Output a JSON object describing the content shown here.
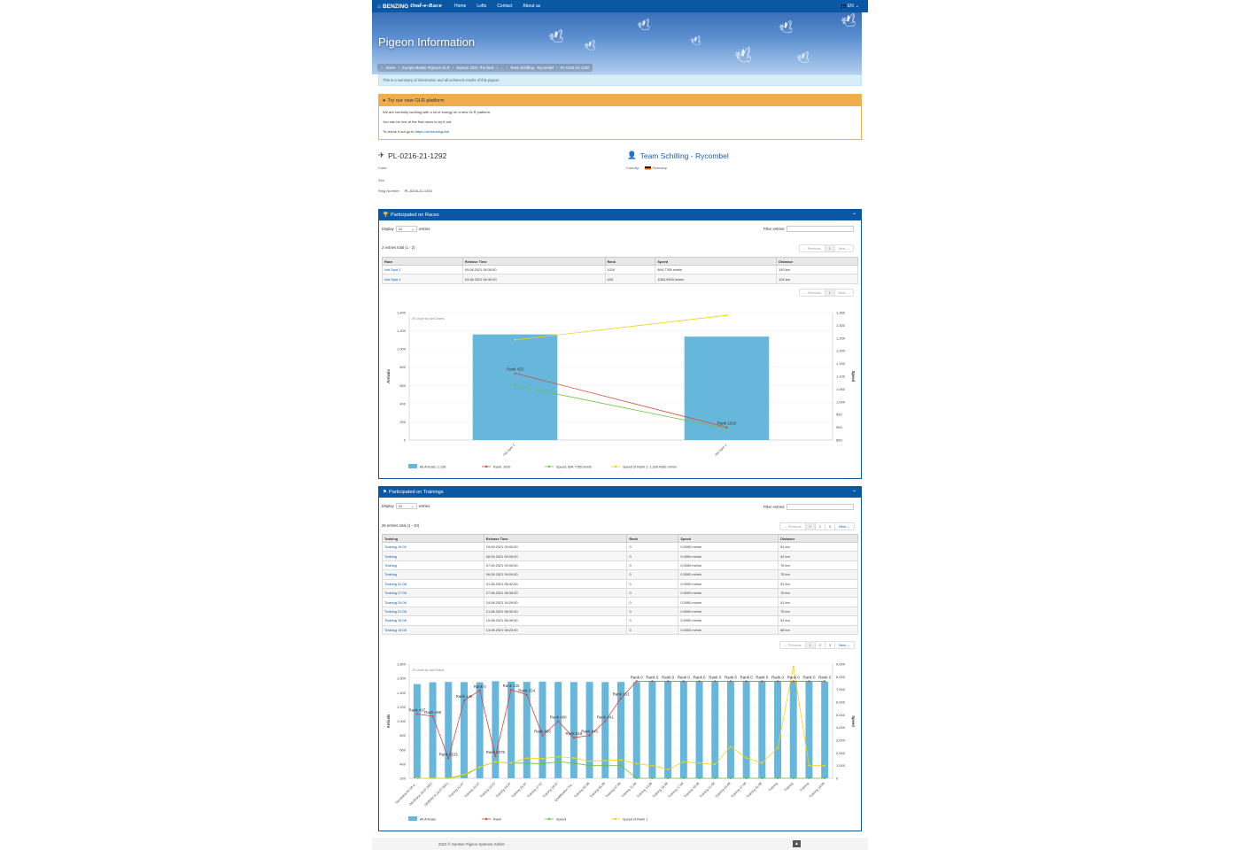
{
  "navbar": {
    "brand": "BENZING",
    "brand_script": "Ond-e-Race",
    "links": [
      "Home",
      "Lofts",
      "Contact",
      "About us"
    ],
    "lang": "EN"
  },
  "hero": {
    "title": "Pigeon Information",
    "breadcrumb": [
      "Home",
      "Europa Master Pigeons OLR",
      "Season 2021 The Best",
      "...",
      "Team Schilling - Rycombel",
      "PL-0216-21-1292"
    ]
  },
  "info_text": "This is a summary of information and all achieved results of this pigeon",
  "promo": {
    "title": "Try our new OLR platform",
    "line1": "We are currently working with a lot of energy on a new OLR platform.",
    "line2": "You can be one of the first users to try it out.",
    "line3_prefix": "To check it out go to",
    "link": "https://olr.benzing.live"
  },
  "pigeon": {
    "ring": "PL-0216-21-1292",
    "color_label": "Color:",
    "sex_label": "Sex:",
    "ring_label": "Ring Number:",
    "ring_value": "PL-0216-21-1292"
  },
  "team": {
    "name": "Team Schilling - Rycombel",
    "country_label": "Country:",
    "country": "Germany"
  },
  "races": {
    "title": "Participated on Races",
    "display_label": "Display",
    "display_value": "10",
    "entries_label": "entries",
    "filter_label": "Filter entries:",
    "total": "2 entries total (1 - 2)",
    "pager": [
      "← Previous",
      "1",
      "Next →"
    ],
    "columns": [
      "Race",
      "Release Time",
      "Rank",
      "Speed",
      "Distance"
    ],
    "rows": [
      [
        "Hot Spot 2",
        "09.08.2021 06:30:00",
        "1010",
        "894.7785 m/min",
        "193 km"
      ],
      [
        "Hot Spot 1",
        "03.08.2021 06:30:00",
        "433",
        "1063.9453 m/min",
        "126 km"
      ]
    ]
  },
  "chart_data": [
    {
      "type": "bar",
      "watermark": "JS chart by amCharts",
      "categories": [
        "Hot Spot 1",
        "Hot Spot 2"
      ],
      "ylabel": "Arrivals",
      "y2label": "Speed",
      "ylim": [
        0,
        1400
      ],
      "y2lim": [
        850,
        1350
      ],
      "yticks": [
        "0",
        "200",
        "400",
        "600",
        "800",
        "1,000",
        "1,200",
        "1,400"
      ],
      "y2ticks": [
        "850",
        "900",
        "950",
        "1,000",
        "1,050",
        "1,100",
        "1,150",
        "1,200",
        "1,250",
        "1,300",
        "1,350"
      ],
      "series": [
        {
          "name": "All Arrivals",
          "kind": "bar",
          "values": [
            1160,
            1136
          ]
        },
        {
          "name": "Rank",
          "kind": "line",
          "axis": "y",
          "values": [
            733,
            140
          ],
          "labels": [
            "Rank 433",
            "Rank 1010"
          ]
        },
        {
          "name": "Speed",
          "kind": "line",
          "axis": "y2",
          "values": [
            1063.9,
            894.8
          ]
        },
        {
          "name": "Speed of Rank 1",
          "kind": "line",
          "axis": "y2",
          "values": [
            1243,
            1339
          ]
        }
      ],
      "legend": [
        "All Arrivals: 1,136",
        "Rank: 1010",
        "Speed: 894.7785 m/min",
        "Speed of Rank 1: 1,339.4282 m/min"
      ],
      "colors": {
        "bar": "#67b7dc",
        "rank": "#d9463c",
        "speed": "#6fbf3f",
        "speed1": "#f5d10f"
      }
    },
    {
      "type": "bar",
      "watermark": "JS chart by amCharts",
      "ylabel": "Arrivals",
      "y2label": "Speed",
      "ylim": [
        200,
        1800
      ],
      "y2lim": [
        0,
        9000
      ],
      "yticks": [
        "200",
        "400",
        "600",
        "800",
        "1,000",
        "1,200",
        "1,400",
        "1,600",
        "1,800"
      ],
      "y2ticks": [
        "0",
        "1,000",
        "2,000",
        "3,000",
        "4,000",
        "5,000",
        "6,000",
        "7,000",
        "8,000",
        "9,000"
      ],
      "categories": [
        "Derdziana 07.06 a...",
        "Derdziana 10.07.2021",
        "DEBRECA 10.07.2021",
        "Training 22.07",
        "Training 23.07",
        "Training 23.07",
        "Training 24.07",
        "Training 25.07",
        "Training 27.07",
        "Training 29.07",
        "Qualification Tra...",
        "Training 02.08",
        "Training 05.08",
        "Training 07.08",
        "Training 11.08",
        "Training 13.08",
        "Training 15.08",
        "Training 17.08",
        "Training 19.08",
        "Training 21.08",
        "Training 24.08",
        "Training 27.08",
        "Training 31.08",
        "Training",
        "Training",
        "Training",
        "Training 19.09"
      ],
      "series": [
        {
          "name": "All Arrivals",
          "kind": "bar",
          "values": [
            1520,
            1545,
            1550,
            1548,
            1545,
            1560,
            1555,
            1550,
            1555,
            1550,
            1548,
            1550,
            1548,
            1550,
            1548,
            1555,
            1555,
            1555,
            1555,
            1555,
            1555,
            1555,
            1555,
            1555,
            1555,
            1555,
            1555
          ]
        },
        {
          "name": "Rank",
          "kind": "line",
          "axis": "y",
          "values": [
            1100,
            1070,
            480,
            1290,
            1430,
            510,
            1440,
            1370,
            800,
            1000,
            770,
            800,
            1000,
            1320,
            1560,
            1560,
            1560,
            1560,
            1560,
            1560,
            1560,
            1560,
            1560,
            1560,
            1560,
            1560,
            1560
          ],
          "labels": [
            "Rank 497",
            "Rank 469",
            "Rank 1015",
            "Rank 146",
            "Rank 0",
            "Rank 1075",
            "Rank 120",
            "Rank 254",
            "Rank 893",
            "Rank 468",
            "Rank 816",
            "Rank 840",
            "Rank 441",
            "Rank 161",
            "Rank 0",
            "Rank 0",
            "Rank 0",
            "Rank 0",
            "Rank 0",
            "Rank 0",
            "Rank 0",
            "Rank 0",
            "Rank 0",
            "Rank 0",
            "Rank 0",
            "Rank 0",
            "Rank 0"
          ]
        },
        {
          "name": "Speed",
          "kind": "line",
          "axis": "y2",
          "values": [
            0,
            0,
            0,
            200,
            900,
            1300,
            1200,
            1200,
            1150,
            1300,
            1200,
            1000,
            1000,
            1000,
            0,
            0,
            0,
            0,
            0,
            0,
            0,
            0,
            0,
            0,
            0,
            0,
            0
          ]
        },
        {
          "name": "Speed of Rank 1",
          "kind": "line",
          "axis": "y2",
          "values": [
            0,
            0,
            0,
            300,
            900,
            1300,
            1200,
            1600,
            1550,
            1700,
            1600,
            1350,
            1400,
            1450,
            1150,
            1000,
            700,
            1300,
            1200,
            1100,
            2500,
            1600,
            1200,
            2400,
            8800,
            1000,
            1000
          ]
        }
      ],
      "legend": [
        "All Arrivals",
        "Rank",
        "Speed",
        "Speed of Rank 1"
      ],
      "colors": {
        "bar": "#67b7dc",
        "rank": "#d9463c",
        "speed": "#6fbf3f",
        "speed1": "#f5d10f"
      }
    }
  ],
  "trainings": {
    "title": "Participated on Trainings",
    "display_label": "Display",
    "display_value": "10",
    "entries_label": "entries",
    "filter_label": "Filter entries:",
    "total": "26 entries total (1 - 10)",
    "pager": [
      "← Previous",
      "1",
      "2",
      "3",
      "Next →"
    ],
    "columns": [
      "Training",
      "Release Time",
      "Rank",
      "Speed",
      "Distance"
    ],
    "rows": [
      [
        "Training 19.09",
        "19.09.2021 09:00:00",
        "0",
        "0.0000 m/min",
        "51 km"
      ],
      [
        "Training",
        "08.09.2021 09:00:00",
        "0",
        "0.0000 m/min",
        "51 km"
      ],
      [
        "Training",
        "07.09.2021 09:00:00",
        "0",
        "0.0000 m/min",
        "75 km"
      ],
      [
        "Training",
        "06.09.2021 09:00:00",
        "0",
        "0.0000 m/min",
        "75 km"
      ],
      [
        "Training 31.08",
        "31.08.2021 08:42:00",
        "0",
        "0.0000 m/min",
        "51 km"
      ],
      [
        "Training 27.08",
        "27.08.2021 08:30:00",
        "0",
        "0.0000 m/min",
        "75 km"
      ],
      [
        "Training 24.08",
        "24.08.2021 19:29:00",
        "0",
        "0.0000 m/min",
        "51 km"
      ],
      [
        "Training 21.08",
        "21.08.2021 08:30:00",
        "0",
        "0.0000 m/min",
        "75 km"
      ],
      [
        "Training 19.08",
        "19.08.2021 08:30:00",
        "0",
        "0.0000 m/min",
        "51 km"
      ],
      [
        "Training 13.08",
        "13.08.2021 08:23:00",
        "0",
        "0.0000 m/min",
        "58 km"
      ]
    ]
  },
  "footer": {
    "copyright": "2022 © Gantner Pigeon Systems GmbH"
  }
}
